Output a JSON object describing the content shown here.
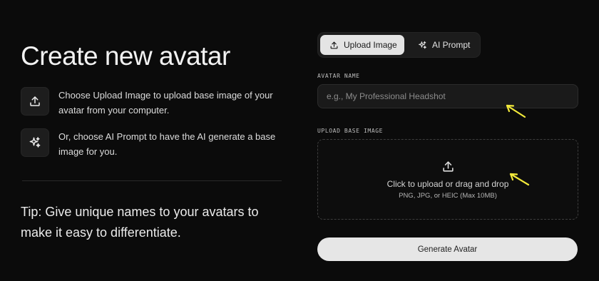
{
  "header": {
    "title": "Create new avatar"
  },
  "info": [
    {
      "icon": "upload-icon",
      "text": "Choose Upload Image to upload base image of your avatar from your computer."
    },
    {
      "icon": "sparkles-icon",
      "text": "Or, choose AI Prompt to have the AI generate a base image for you."
    }
  ],
  "tip": "Tip: Give unique names to your avatars to make it easy to differentiate.",
  "tabs": [
    {
      "label": "Upload Image",
      "icon": "upload-icon",
      "active": true
    },
    {
      "label": "AI Prompt",
      "icon": "sparkles-icon",
      "active": false
    }
  ],
  "form": {
    "name_label": "AVATAR NAME",
    "name_placeholder": "e.g., My Professional Headshot",
    "name_value": "",
    "upload_label": "UPLOAD BASE IMAGE",
    "upload_main": "Click to upload or drag and drop",
    "upload_hint": "PNG, JPG, or HEIC (Max 10MB)",
    "submit_label": "Generate Avatar"
  },
  "colors": {
    "background": "#0b0b0b",
    "active_tab": "#e4e4e4",
    "annotation_arrow": "#f2e93a"
  }
}
